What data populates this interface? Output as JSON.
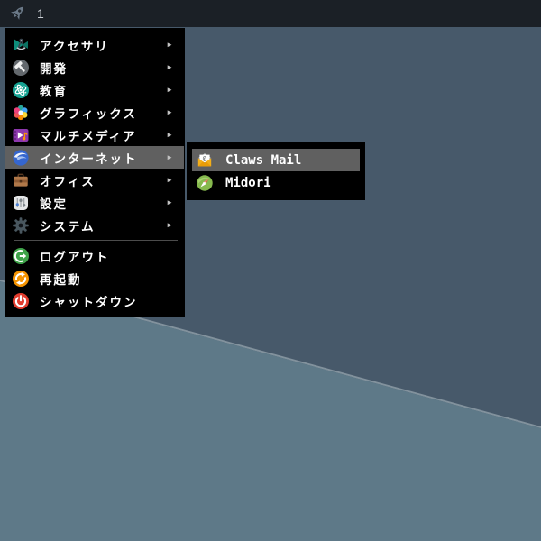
{
  "topbar": {
    "workspace_label": "1",
    "launcher_icon": "rocket-icon"
  },
  "menu": {
    "arrow_glyph": "►",
    "categories": [
      {
        "label": "アクセサリ",
        "icon": "accessories-icon"
      },
      {
        "label": "開発",
        "icon": "development-icon"
      },
      {
        "label": "教育",
        "icon": "education-icon"
      },
      {
        "label": "グラフィックス",
        "icon": "graphics-icon"
      },
      {
        "label": "マルチメディア",
        "icon": "multimedia-icon"
      },
      {
        "label": "インターネット",
        "icon": "internet-icon",
        "highlighted": true
      },
      {
        "label": "オフィス",
        "icon": "office-icon"
      },
      {
        "label": "設定",
        "icon": "settings-icon"
      },
      {
        "label": "システム",
        "icon": "system-icon"
      }
    ],
    "actions": [
      {
        "label": "ログアウト",
        "icon": "logout-icon"
      },
      {
        "label": "再起動",
        "icon": "restart-icon"
      },
      {
        "label": "シャットダウン",
        "icon": "shutdown-icon"
      }
    ]
  },
  "submenu": {
    "items": [
      {
        "label": "Claws Mail",
        "icon": "claws-mail-icon",
        "highlighted": true
      },
      {
        "label": "Midori",
        "icon": "midori-icon"
      }
    ]
  },
  "colors": {
    "topbar_bg": "#1b2026",
    "desktop_dark": "#47596a",
    "desktop_light": "#5e7988",
    "menu_bg": "#000000",
    "highlight_bg": "#606060",
    "menu_text": "#ffffff",
    "separator": "#4c4c4c",
    "logout_green": "#3fa44a",
    "restart_orange": "#f59402",
    "shutdown_red": "#e23d2e",
    "internet_blue": "#3566cf"
  }
}
